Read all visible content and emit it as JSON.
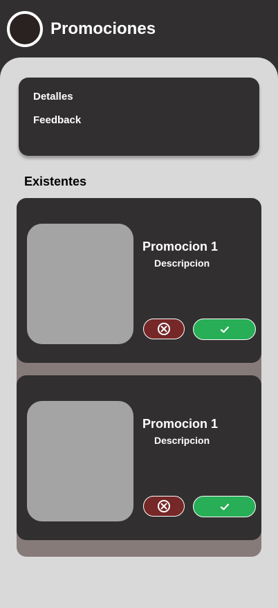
{
  "header": {
    "title": "Promociones",
    "avatar_icon": "avatar-circle-icon"
  },
  "menu": {
    "items": [
      {
        "label": "Detalles"
      },
      {
        "label": "Feedback"
      }
    ]
  },
  "section": {
    "title": "Existentes"
  },
  "promotions": [
    {
      "name": "Promocion 1",
      "description": "Descripcion",
      "reject_icon": "circle-x-icon",
      "accept_icon": "check-icon"
    },
    {
      "name": "Promocion 1",
      "description": "Descripcion",
      "reject_icon": "circle-x-icon",
      "accept_icon": "check-icon"
    }
  ],
  "colors": {
    "dark": "#312f30",
    "panel": "#d9d9d9",
    "reject": "#762727",
    "accept": "#27ae56",
    "image_placeholder": "#a4a4a4",
    "list_background": "#877b7a"
  }
}
